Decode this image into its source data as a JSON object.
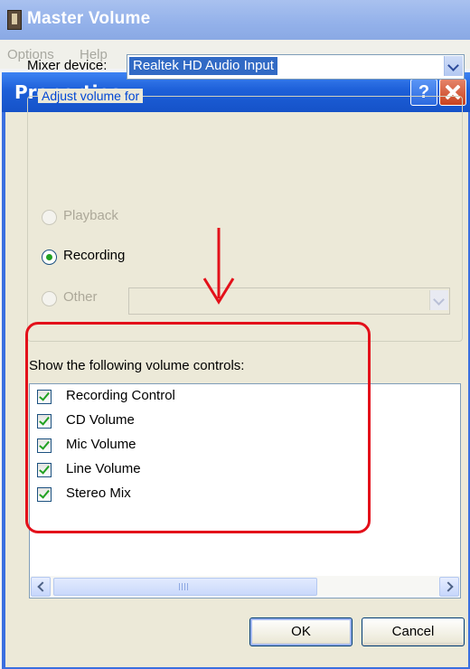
{
  "background_window": {
    "title": "Master Volume",
    "menu": [
      "Options",
      "Help"
    ]
  },
  "dialog": {
    "title": "Properties",
    "help_glyph": "?",
    "mixer_label": "Mixer device:",
    "mixer_value": "Realtek HD Audio Input",
    "adjust_legend": "Adjust volume for",
    "radios": [
      {
        "label": "Playback",
        "enabled": false,
        "selected": false
      },
      {
        "label": "Recording",
        "enabled": true,
        "selected": true
      },
      {
        "label": "Other",
        "enabled": false,
        "selected": false
      }
    ],
    "show_label": "Show the following volume controls:",
    "controls": [
      {
        "label": "Recording Control",
        "checked": true
      },
      {
        "label": "CD Volume",
        "checked": true
      },
      {
        "label": "Mic Volume",
        "checked": true
      },
      {
        "label": "Line Volume",
        "checked": true
      },
      {
        "label": "Stereo Mix",
        "checked": true
      }
    ],
    "ok_label": "OK",
    "cancel_label": "Cancel"
  },
  "colors": {
    "annotation_red": "#e3101a",
    "title_blue": "#1d5fd8",
    "check_green": "#21a121"
  }
}
